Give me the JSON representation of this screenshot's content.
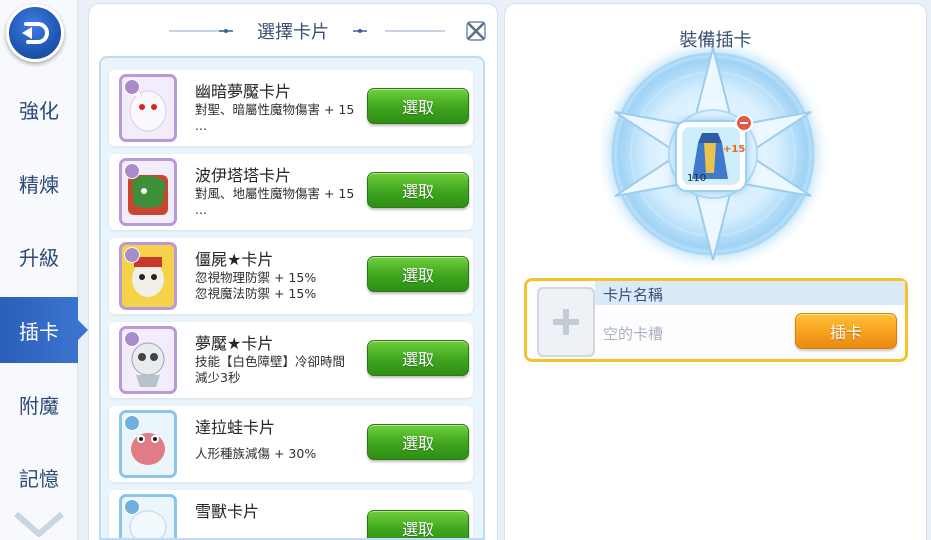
{
  "sidebar": {
    "back_icon": "back-arrow-icon",
    "items": [
      {
        "label": "強化",
        "active": false
      },
      {
        "label": "精煉",
        "active": false
      },
      {
        "label": "升級",
        "active": false
      },
      {
        "label": "插卡",
        "active": true
      },
      {
        "label": "附魔",
        "active": false
      },
      {
        "label": "記憶",
        "active": false
      }
    ]
  },
  "card_panel": {
    "title": "選擇卡片",
    "cards": [
      {
        "name": "幽暗夢魘卡片",
        "desc1": "對聖、暗屬性魔物傷害 + 15",
        "desc2": "...",
        "button": "選取",
        "frame": "purple"
      },
      {
        "name": "波伊塔塔卡片",
        "desc1": "對風、地屬性魔物傷害 + 15",
        "desc2": "...",
        "button": "選取",
        "frame": "purple"
      },
      {
        "name": "僵屍★卡片",
        "desc1": "忽視物理防禦 + 15%",
        "desc2": "忽視魔法防禦 + 15%",
        "button": "選取",
        "frame": "purple"
      },
      {
        "name": "夢魘★卡片",
        "desc1": "技能【白色障壁】冷卻時間",
        "desc2": "減少3秒",
        "button": "選取",
        "frame": "purple"
      },
      {
        "name": "達拉蛙卡片",
        "desc1": "人形種族減傷 + 30%",
        "desc2": "",
        "button": "選取",
        "frame": "blue"
      },
      {
        "name": "雪獸卡片",
        "desc1": "",
        "desc2": "",
        "button": "選取",
        "frame": "blue"
      }
    ]
  },
  "equip_panel": {
    "title": "裝備插卡",
    "item_level": "110",
    "item_refine": "+15",
    "slot": {
      "name_label": "卡片名稱",
      "empty_text": "空的卡槽",
      "button": "插卡"
    }
  },
  "colors": {
    "accent_blue": "#2b5fb8",
    "select_green": "#3ea51f",
    "insert_orange": "#f7a01e",
    "slot_border": "#f5c22a"
  }
}
